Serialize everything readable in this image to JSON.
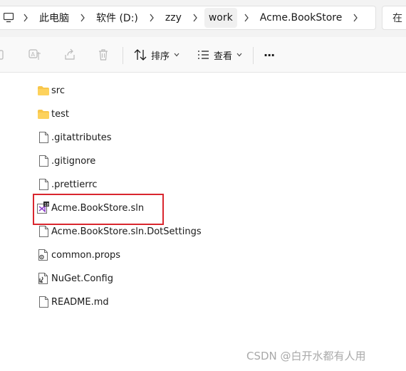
{
  "address": {
    "crumbs": [
      "此电脑",
      "软件 (D:)",
      "zzy",
      "work",
      "Acme.BookStore"
    ],
    "search_text": "在"
  },
  "toolbar": {
    "sort_label": "排序",
    "view_label": "查看",
    "more_label": "···"
  },
  "files": [
    {
      "name": "src",
      "type": "folder"
    },
    {
      "name": "test",
      "type": "folder"
    },
    {
      "name": ".gitattributes",
      "type": "file"
    },
    {
      "name": ".gitignore",
      "type": "file"
    },
    {
      "name": ".prettierrc",
      "type": "file"
    },
    {
      "name": "Acme.BookStore.sln",
      "type": "solution"
    },
    {
      "name": "Acme.BookStore.sln.DotSettings",
      "type": "file"
    },
    {
      "name": "common.props",
      "type": "props"
    },
    {
      "name": "NuGet.Config",
      "type": "config"
    },
    {
      "name": "README.md",
      "type": "file"
    }
  ],
  "watermark": "CSDN @白开水都有人用",
  "colors": {
    "folder": "#f8c64a",
    "highlight": "#d9262e",
    "vs_purple": "#8b3fc8"
  }
}
